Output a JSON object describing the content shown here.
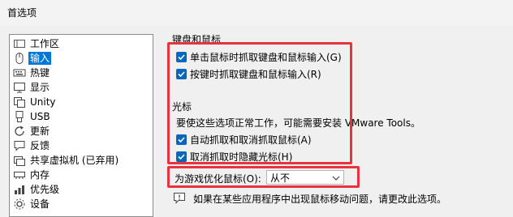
{
  "window": {
    "title": "首选项"
  },
  "sidebar": {
    "items": [
      {
        "label": "工作区",
        "icon": "workspace-icon"
      },
      {
        "label": "输入",
        "icon": "mouse-icon",
        "selected": true
      },
      {
        "label": "热键",
        "icon": "keyboard-icon"
      },
      {
        "label": "显示",
        "icon": "display-icon"
      },
      {
        "label": "Unity",
        "icon": "unity-icon"
      },
      {
        "label": "USB",
        "icon": "usb-icon"
      },
      {
        "label": "更新",
        "icon": "refresh-icon"
      },
      {
        "label": "反馈",
        "icon": "feedback-icon"
      },
      {
        "label": "共享虚拟机 (已弃用)",
        "icon": "shared-vm-icon"
      },
      {
        "label": "内存",
        "icon": "memory-icon"
      },
      {
        "label": "优先级",
        "icon": "priority-icon"
      },
      {
        "label": "设备",
        "icon": "device-icon"
      }
    ]
  },
  "keyboard_mouse": {
    "heading": "键盘和鼠标",
    "options": [
      {
        "label": "单击鼠标时抓取键盘和鼠标输入(G)",
        "checked": true
      },
      {
        "label": "按键时抓取键盘和鼠标输入(R)",
        "checked": true
      }
    ]
  },
  "cursor": {
    "heading": "光标",
    "note": "要使这些选项正常工作，可能需要安装 VMware Tools。",
    "options": [
      {
        "label": "自动抓取和取消抓取鼠标(A)",
        "checked": true
      },
      {
        "label": "取消抓取时隐藏光标(H)",
        "checked": true
      }
    ]
  },
  "game_optimize": {
    "label": "为游戏优化鼠标(O):",
    "selected": "从不"
  },
  "info": {
    "text": "如果在某些应用程序中出现鼠标移动问题，请更改此选项。"
  },
  "colors": {
    "accent": "#0067c0",
    "highlight": "#e8323c",
    "selection": "#0078d7"
  }
}
